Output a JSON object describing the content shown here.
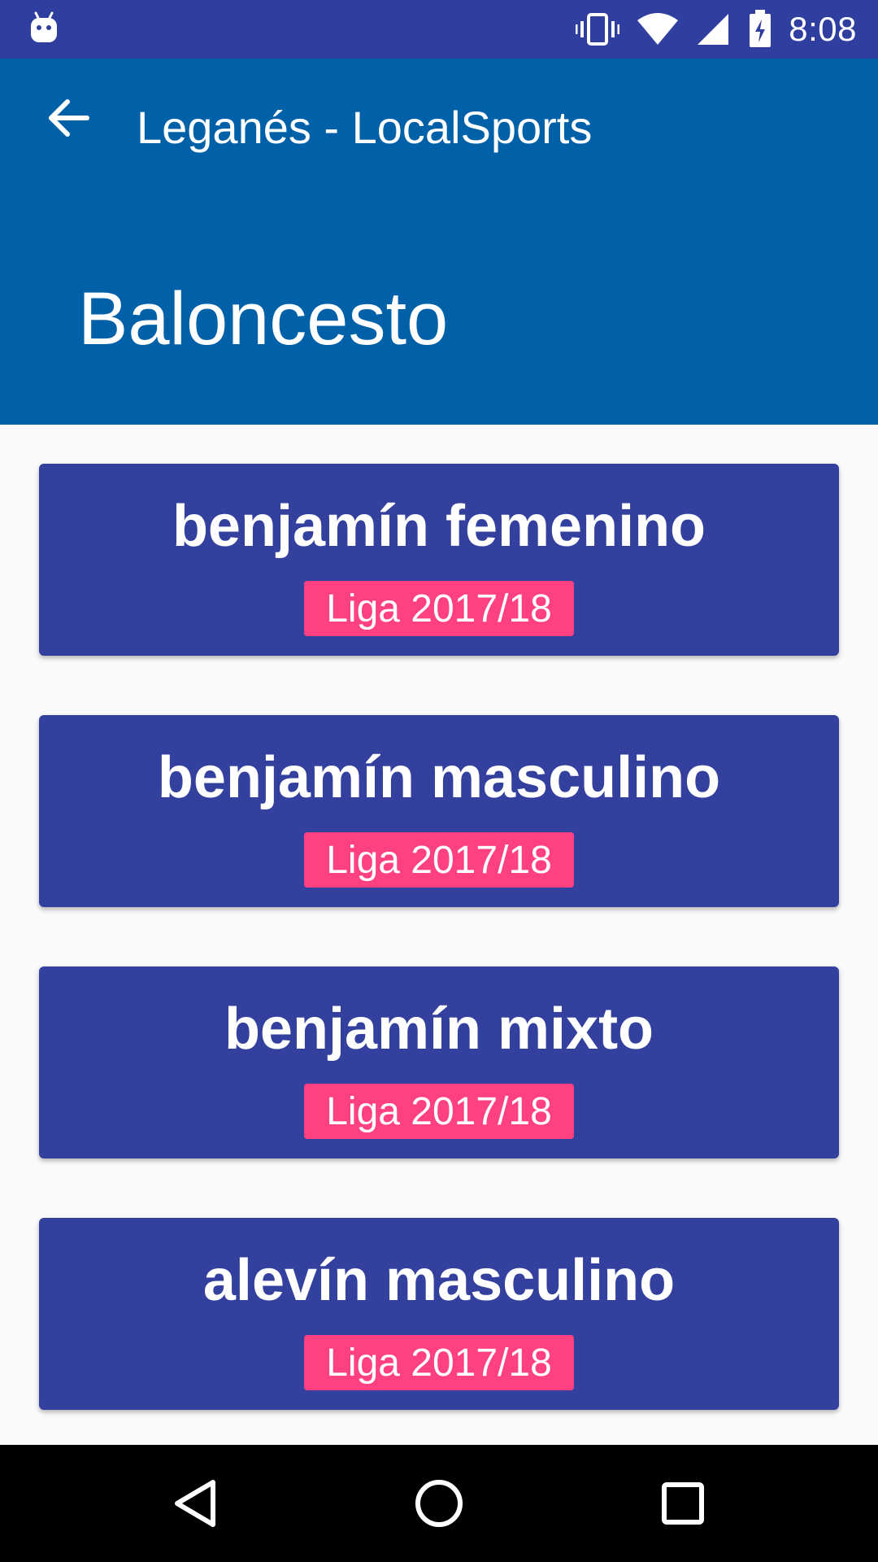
{
  "status_bar": {
    "time": "8:08",
    "icons": [
      "android-icon",
      "vibrate-icon",
      "wifi-icon",
      "signal-icon",
      "battery-charging-icon"
    ]
  },
  "toolbar": {
    "title": "Leganés - LocalSports",
    "back_icon": "arrow-back-icon"
  },
  "header": {
    "title": "Baloncesto"
  },
  "colors": {
    "status_bar": "#303f9f",
    "header": "#0060a8",
    "card": "#33409e",
    "badge": "#ff4081",
    "background": "#fafafa",
    "nav_bar": "#000000"
  },
  "categories": [
    {
      "name": "benjamín femenino",
      "league": "Liga 2017/18"
    },
    {
      "name": "benjamín masculino",
      "league": "Liga 2017/18"
    },
    {
      "name": "benjamín mixto",
      "league": "Liga 2017/18"
    },
    {
      "name": "alevín masculino",
      "league": "Liga 2017/18"
    }
  ],
  "nav_bar": {
    "buttons": [
      "back-triangle-icon",
      "home-circle-icon",
      "recents-square-icon"
    ]
  }
}
